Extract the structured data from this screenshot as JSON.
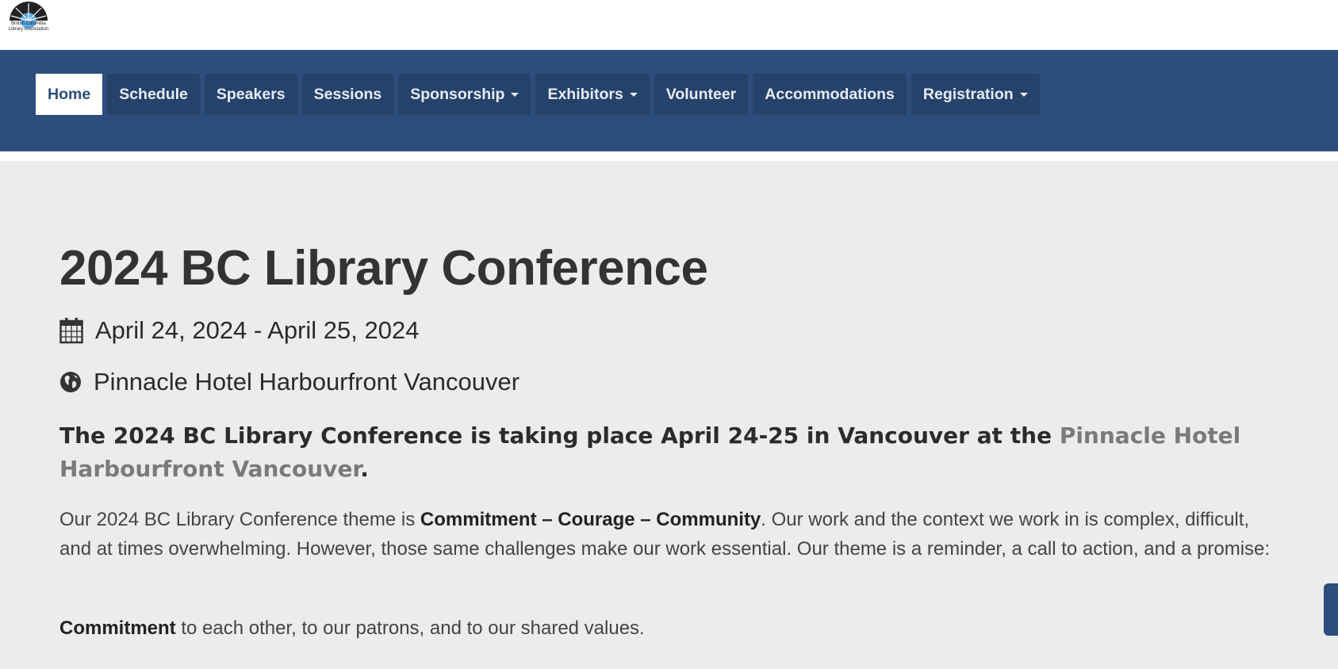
{
  "logo": {
    "text_line1": "British Columbia",
    "text_line2": "Library Association"
  },
  "nav": {
    "items": [
      {
        "label": "Home",
        "active": true,
        "dropdown": false
      },
      {
        "label": "Schedule",
        "active": false,
        "dropdown": false
      },
      {
        "label": "Speakers",
        "active": false,
        "dropdown": false
      },
      {
        "label": "Sessions",
        "active": false,
        "dropdown": false
      },
      {
        "label": "Sponsorship",
        "active": false,
        "dropdown": true
      },
      {
        "label": "Exhibitors",
        "active": false,
        "dropdown": true
      },
      {
        "label": "Volunteer",
        "active": false,
        "dropdown": false
      },
      {
        "label": "Accommodations",
        "active": false,
        "dropdown": false
      },
      {
        "label": "Registration",
        "active": false,
        "dropdown": true
      }
    ]
  },
  "event": {
    "title": "2024 BC Library Conference",
    "date_icon": "calendar-icon",
    "dates": "April 24, 2024 - April 25, 2024",
    "location_icon": "globe-icon",
    "location": "Pinnacle Hotel Harbourfront Vancouver"
  },
  "lead": {
    "text": "The 2024 BC Library Conference is taking place April 24-25 in Vancouver at the ",
    "link": "Pinnacle Hotel Harbourfront Vancouver",
    "end": "."
  },
  "body": {
    "p1_start": "Our 2024 BC Library Conference theme is ",
    "p1_bold": "Commitment – Courage – Community",
    "p1_end": ". Our work and the context we work in is complex, difficult, and at times overwhelming. However, those same challenges make our work essential. Our theme is a reminder, a call to action, and a promise:",
    "p2_bold": "Commitment",
    "p2_end": " to each other, to our patrons, and to our shared values."
  },
  "colors": {
    "nav_bg": "#2d4e7c",
    "nav_item_bg": "#25426b",
    "page_bg": "#ececec",
    "link": "#7a7a7a"
  }
}
